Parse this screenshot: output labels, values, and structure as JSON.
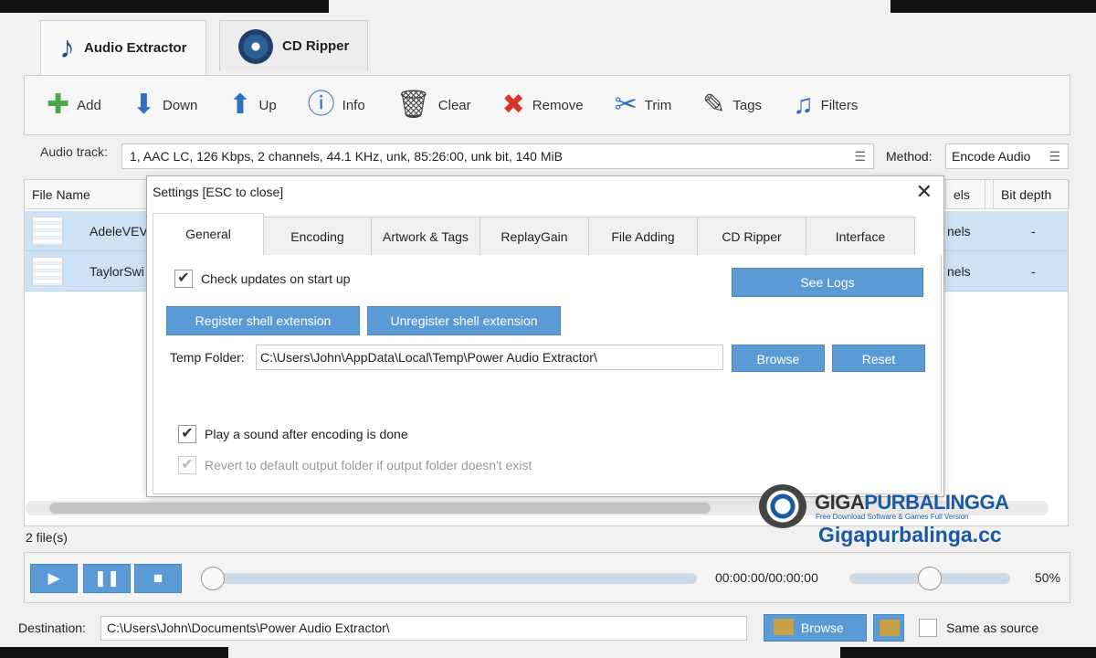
{
  "tabs": [
    {
      "label": "Audio Extractor",
      "icon": "music-note-icon"
    },
    {
      "label": "CD Ripper",
      "icon": "cd-icon"
    }
  ],
  "toolbar": {
    "add": "Add",
    "down": "Down",
    "up": "Up",
    "info": "Info",
    "clear": "Clear",
    "remove": "Remove",
    "trim": "Trim",
    "tags": "Tags",
    "filters": "Filters"
  },
  "audio_track": {
    "label": "Audio track:",
    "value": "1, AAC LC, 126 Kbps, 2 channels, 44.1 KHz, unk, 85:26:00, unk bit, 140 MiB"
  },
  "method": {
    "label": "Method:",
    "value": "Encode Audio"
  },
  "table": {
    "headers": {
      "file_name": "File Name",
      "channels": "els",
      "bit_depth": "Bit depth"
    },
    "rows": [
      {
        "name": "AdeleVEV",
        "channels": "nels",
        "bit_depth": "-"
      },
      {
        "name": "TaylorSwi",
        "channels": "nels",
        "bit_depth": "-"
      }
    ]
  },
  "files_count": "2 file(s)",
  "player": {
    "time": "00:00:00/00:00:00",
    "volume": "50%",
    "volume_level": 0.5,
    "progress": 0
  },
  "destination": {
    "label": "Destination:",
    "value": "C:\\Users\\John\\Documents\\Power Audio Extractor\\",
    "browse": "Browse",
    "same_as_source": "Same as source"
  },
  "dialog": {
    "title": "Settings [ESC to close]",
    "tabs": [
      "General",
      "Encoding",
      "Artwork & Tags",
      "ReplayGain",
      "File Adding",
      "CD Ripper",
      "Interface"
    ],
    "check_updates": "Check updates on start up",
    "see_logs": "See Logs",
    "register": "Register shell extension",
    "unregister": "Unregister shell extension",
    "temp_label": "Temp Folder:",
    "temp_value": "C:\\Users\\John\\AppData\\Local\\Temp\\Power Audio Extractor\\",
    "browse": "Browse",
    "reset": "Reset",
    "play_sound": "Play a sound after encoding is done",
    "revert": "Revert to default output folder if output folder doesn't exist"
  },
  "watermark": {
    "brand_part1": "GIGA",
    "brand_part2": "PURBALINGGA",
    "tagline": "Free Download Software & Games Full Version",
    "url": "Gigapurbalinga.cc"
  }
}
